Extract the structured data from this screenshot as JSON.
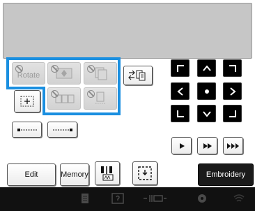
{
  "edit_panel": {
    "rotate_label": "Rotate"
  },
  "toolbar": {
    "edit_label": "Edit",
    "memory_label": "Memory",
    "embroidery_label": "Embroidery"
  },
  "icons": {
    "rotate": "rotate-icon",
    "layout": "pattern-layout-icon",
    "multi_color": "multi-color-icon",
    "border_repeat": "border-repeat-icon",
    "group_edit": "group-edit-icon",
    "duplicate": "duplicate-icon",
    "center_size": "center-size-icon",
    "line_left": "line-left-icon",
    "line_right": "line-right-icon",
    "arrows": [
      "up-left-icon",
      "up-icon",
      "up-right-icon",
      "left-icon",
      "center-icon",
      "right-icon",
      "down-left-icon",
      "down-icon",
      "down-right-icon"
    ],
    "play": [
      "play-icon",
      "fast-forward-icon",
      "fastest-forward-icon"
    ],
    "hoop": "hoop-frame-icon",
    "needle": "needle-icon",
    "status": [
      "document-icon",
      "help-icon",
      "thread-icon",
      "settings-icon",
      "wifi-icon"
    ]
  },
  "colors": {
    "highlight": "#1a8fe0",
    "status_bar": "#111111",
    "embroidery_bg": "#1a1a1a"
  }
}
